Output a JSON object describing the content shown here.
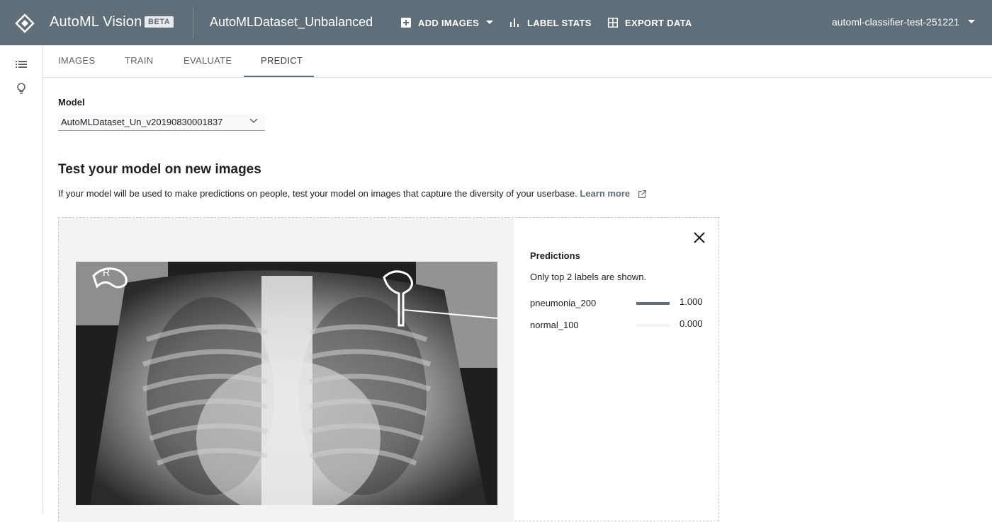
{
  "header": {
    "product_name": "AutoML Vision",
    "beta_badge": "BETA",
    "dataset_name": "AutoMLDataset_Unbalanced",
    "add_images_label": "ADD IMAGES",
    "label_stats_label": "LABEL STATS",
    "export_data_label": "EXPORT DATA",
    "project_name": "automl-classifier-test-251221"
  },
  "rail": {
    "icons": [
      "list-icon",
      "lightbulb-icon"
    ]
  },
  "tabs": [
    {
      "label": "IMAGES",
      "active": false
    },
    {
      "label": "TRAIN",
      "active": false
    },
    {
      "label": "EVALUATE",
      "active": false
    },
    {
      "label": "PREDICT",
      "active": true
    }
  ],
  "model": {
    "label": "Model",
    "selected": "AutoMLDataset_Un_v20190830001837"
  },
  "test_section": {
    "title": "Test your model on new images",
    "description": "If your model will be used to make predictions on people, test your model on images that capture the diversity of your userbase.",
    "learn_more": "Learn more"
  },
  "predictions": {
    "title": "Predictions",
    "note": "Only top 2 labels are shown.",
    "items": [
      {
        "label": "pneumonia_200",
        "score": 1.0,
        "score_text": "1.000"
      },
      {
        "label": "normal_100",
        "score": 0.0,
        "score_text": "0.000"
      }
    ]
  },
  "colors": {
    "header_bg": "#5f6e78",
    "accent": "#5f6e78"
  }
}
